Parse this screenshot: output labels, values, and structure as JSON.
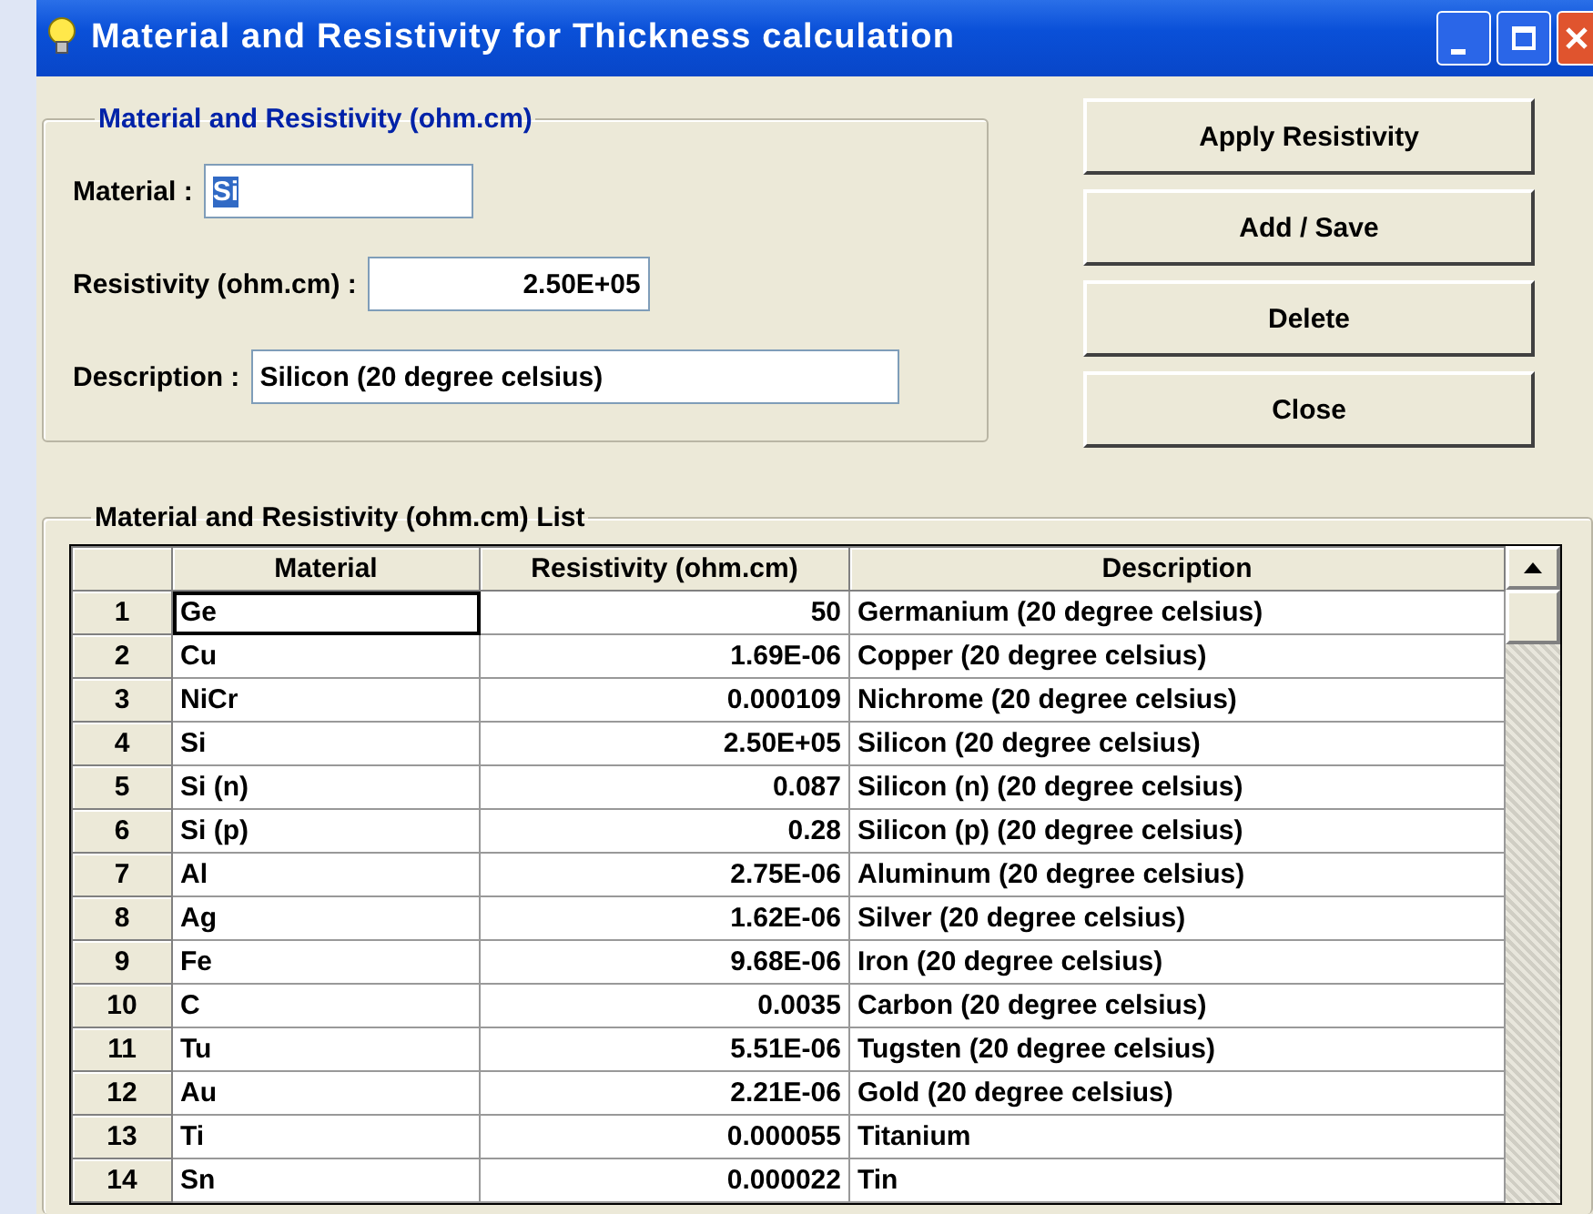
{
  "window": {
    "title": "Material and Resistivity for Thickness calculation"
  },
  "editor": {
    "title": "Material and Resistivity (ohm.cm)",
    "fields": [
      {
        "label": "Material :",
        "value": "Si",
        "text_selected": true,
        "kind": "short"
      },
      {
        "label": "Resistivity (ohm.cm) :",
        "value": "2.50E+05",
        "text_selected": false,
        "kind": "number"
      },
      {
        "label": "Description :",
        "value": "Silicon (20 degree celsius)",
        "text_selected": false,
        "kind": "long"
      }
    ]
  },
  "buttons": [
    "Apply Resistivity",
    "Add / Save",
    "Delete",
    "Close"
  ],
  "list": {
    "title": "Material and Resistivity (ohm.cm) List",
    "columns": [
      "Material",
      "Resistivity (ohm.cm)",
      "Description"
    ],
    "rows": [
      {
        "index": "1",
        "material": "Ge",
        "resistivity": "50",
        "description": "Germanium (20 degree celsius)",
        "current": true
      },
      {
        "index": "2",
        "material": "Cu",
        "resistivity": "1.69E-06",
        "description": "Copper (20 degree celsius)",
        "current": false
      },
      {
        "index": "3",
        "material": "NiCr",
        "resistivity": "0.000109",
        "description": "Nichrome (20 degree celsius)",
        "current": false
      },
      {
        "index": "4",
        "material": "Si",
        "resistivity": "2.50E+05",
        "description": "Silicon (20 degree celsius)",
        "current": false
      },
      {
        "index": "5",
        "material": "Si (n)",
        "resistivity": "0.087",
        "description": "Silicon (n) (20 degree celsius)",
        "current": false
      },
      {
        "index": "6",
        "material": "Si (p)",
        "resistivity": "0.28",
        "description": "Silicon (p) (20 degree celsius)",
        "current": false
      },
      {
        "index": "7",
        "material": "Al",
        "resistivity": "2.75E-06",
        "description": "Aluminum (20 degree celsius)",
        "current": false
      },
      {
        "index": "8",
        "material": "Ag",
        "resistivity": "1.62E-06",
        "description": "Silver (20 degree celsius)",
        "current": false
      },
      {
        "index": "9",
        "material": "Fe",
        "resistivity": "9.68E-06",
        "description": "Iron (20 degree celsius)",
        "current": false
      },
      {
        "index": "10",
        "material": "C",
        "resistivity": "0.0035",
        "description": "Carbon (20 degree celsius)",
        "current": false
      },
      {
        "index": "11",
        "material": "Tu",
        "resistivity": "5.51E-06",
        "description": "Tugsten (20 degree celsius)",
        "current": false
      },
      {
        "index": "12",
        "material": "Au",
        "resistivity": "2.21E-06",
        "description": "Gold (20 degree celsius)",
        "current": false
      },
      {
        "index": "13",
        "material": "Ti",
        "resistivity": "0.000055",
        "description": "Titanium",
        "current": false
      },
      {
        "index": "14",
        "material": "Sn",
        "resistivity": "0.000022",
        "description": "Tin",
        "current": false
      }
    ]
  }
}
